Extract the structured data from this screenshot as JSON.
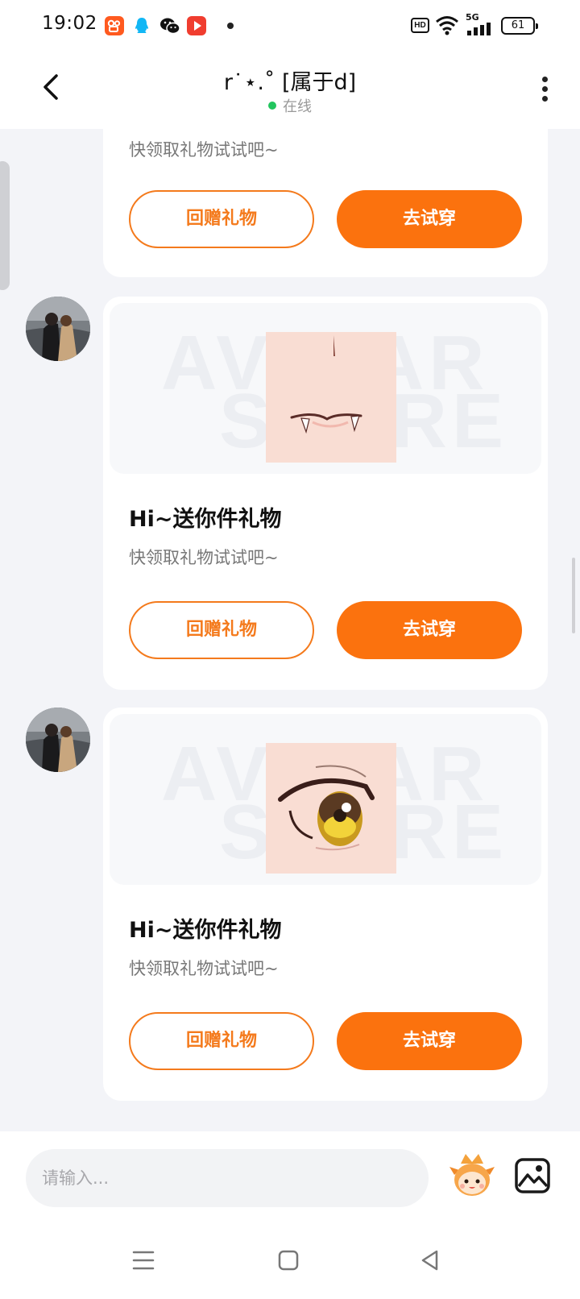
{
  "status_bar": {
    "time": "19:02",
    "hd_label": "HD",
    "network_label": "5G",
    "battery_level": "61",
    "apps": [
      "kuaishou-icon",
      "qq-icon",
      "wechat-icon",
      "video-icon"
    ]
  },
  "header": {
    "title": "r˙⋆.˚ [属于d]",
    "online_status": "在线"
  },
  "partial_card": {
    "subtitle": "快领取礼物试试吧~",
    "return_gift_label": "回赠礼物",
    "try_on_label": "去试穿"
  },
  "messages": [
    {
      "item_icon": "mouth-fangs-icon",
      "watermark": "AVATAR STORE",
      "title": "Hi~送你件礼物",
      "subtitle": "快领取礼物试试吧~",
      "return_gift_label": "回赠礼物",
      "try_on_label": "去试穿"
    },
    {
      "item_icon": "anime-eye-icon",
      "watermark": "AVATAR STORE",
      "title": "Hi~送你件礼物",
      "subtitle": "快领取礼物试试吧~",
      "return_gift_label": "回赠礼物",
      "try_on_label": "去试穿"
    }
  ],
  "input": {
    "placeholder": "请输入..."
  },
  "colors": {
    "accent": "#fb720e",
    "online": "#22c55e",
    "background": "#f3f4f8"
  }
}
